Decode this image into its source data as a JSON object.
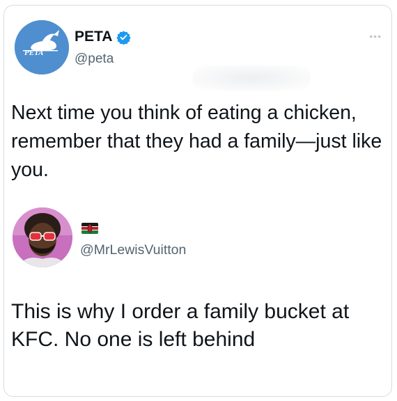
{
  "tweet": {
    "display_name": "PETA",
    "handle": "@peta",
    "avatar_text": "PETA",
    "text": "Next time you think of eating a chicken, remember that they had a family—just like you."
  },
  "reply": {
    "handle": "@MrLewisVuitton",
    "text": "This is why I order a family bucket at KFC. No one is left behind"
  },
  "icons": {
    "verified": "verified-badge-icon",
    "more": "more-options-icon",
    "flag": "kenya-flag-icon"
  },
  "colors": {
    "verified_blue": "#1d9bf0",
    "peta_blue": "#4f8fd0",
    "handle_gray": "#536471"
  }
}
